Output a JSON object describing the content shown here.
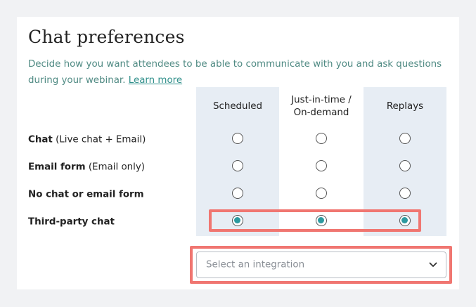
{
  "section": {
    "title": "Chat preferences",
    "description": "Decide how you want attendees to be able to communicate with you and ask questions during your webinar.",
    "learn_more": "Learn more"
  },
  "columns": [
    "Scheduled",
    "Just-in-time /\nOn-demand",
    "Replays"
  ],
  "rows": [
    {
      "bold": "Chat",
      "normal": " (Live chat + Email)",
      "selected": [
        false,
        false,
        false
      ]
    },
    {
      "bold": "Email form",
      "normal": " (Email only)",
      "selected": [
        false,
        false,
        false
      ]
    },
    {
      "bold": "No chat or email form",
      "normal": "",
      "selected": [
        false,
        false,
        false
      ]
    },
    {
      "bold": "Third-party chat",
      "normal": "",
      "selected": [
        true,
        true,
        true
      ]
    }
  ],
  "integration_select": {
    "placeholder": "Select an integration",
    "icon": "chevron-down-icon"
  },
  "colors": {
    "accent": "#2c9aa0",
    "highlight": "#f07671",
    "column_bg": "#e7edf4",
    "description_text": "#4f8a83"
  }
}
